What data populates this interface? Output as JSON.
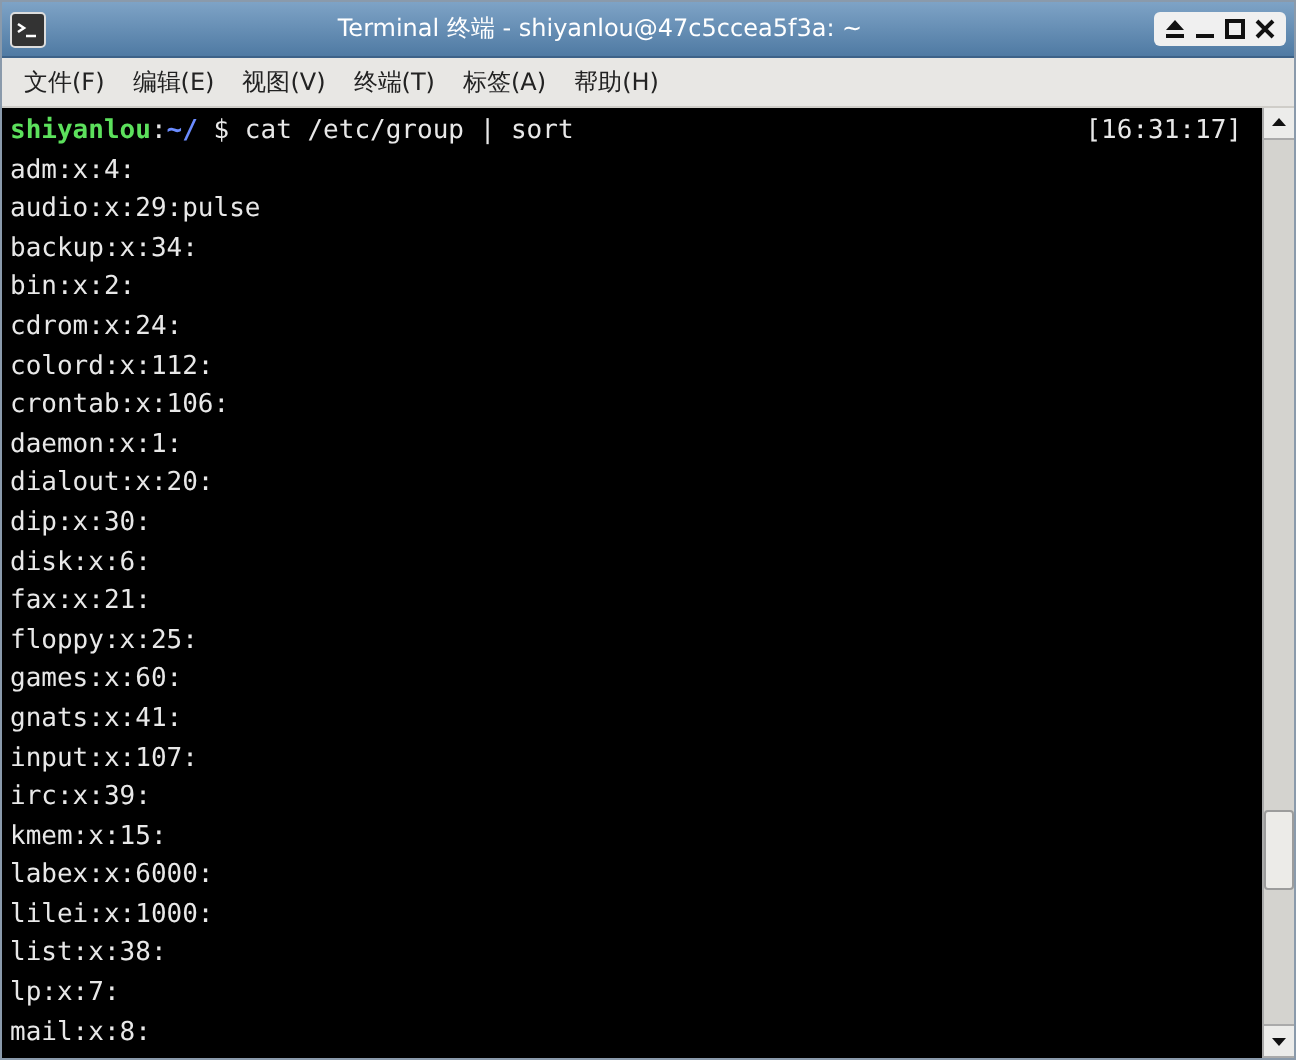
{
  "window": {
    "title": "Terminal 终端 - shiyanlou@47c5ccea5f3a: ~"
  },
  "menu": [
    "文件(F)",
    "编辑(E)",
    "视图(V)",
    "终端(T)",
    "标签(A)",
    "帮助(H)"
  ],
  "prompt": {
    "user": "shiyanlou",
    "separator": ":",
    "path": "~/",
    "command": "$ cat /etc/group | sort",
    "time": "[16:31:17]"
  },
  "output": [
    "adm:x:4:",
    "audio:x:29:pulse",
    "backup:x:34:",
    "bin:x:2:",
    "cdrom:x:24:",
    "colord:x:112:",
    "crontab:x:106:",
    "daemon:x:1:",
    "dialout:x:20:",
    "dip:x:30:",
    "disk:x:6:",
    "fax:x:21:",
    "floppy:x:25:",
    "games:x:60:",
    "gnats:x:41:",
    "input:x:107:",
    "irc:x:39:",
    "kmem:x:15:",
    "labex:x:6000:",
    "lilei:x:1000:",
    "list:x:38:",
    "lp:x:7:",
    "mail:x:8:"
  ]
}
